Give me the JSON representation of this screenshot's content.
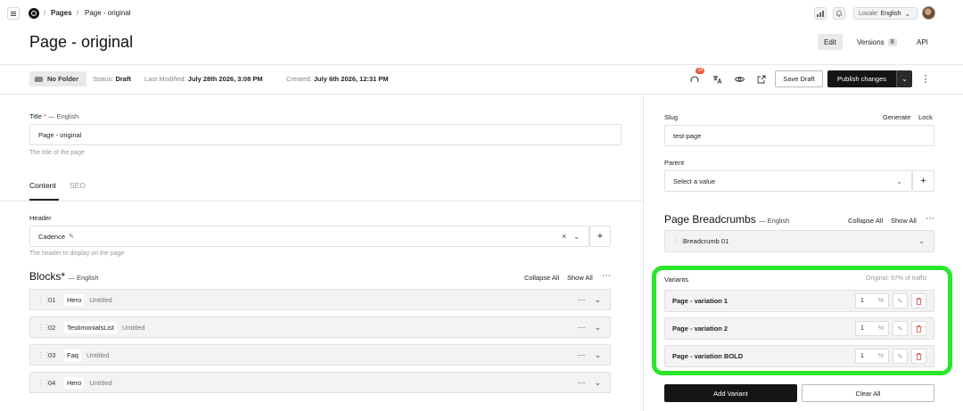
{
  "nav": {
    "breadcrumb_pages": "Pages",
    "breadcrumb_current": "Page - original",
    "locale_label": "Locale:",
    "locale_value": "English"
  },
  "header": {
    "title": "Page - original",
    "tabs": [
      {
        "label": "Edit"
      },
      {
        "label": "Versions",
        "count": "8"
      },
      {
        "label": "API"
      }
    ]
  },
  "status": {
    "folder": "No Folder",
    "status_label": "Status:",
    "status_value": "Draft",
    "modified_label": "Last Modified:",
    "modified_value": "July 28th 2026, 3:08 PM",
    "created_label": "Created:",
    "created_value": "July 6th 2026, 12:31 PM",
    "notification_count": "14",
    "save_draft": "Save Draft",
    "publish": "Publish changes"
  },
  "form": {
    "title_label": "Title",
    "title_required": "*",
    "title_locale": "— English",
    "title_value": "Page - original",
    "title_hint": "The title of the page",
    "tabs": [
      "Content",
      "SEO"
    ],
    "header_label": "Header",
    "header_value": "Cadence",
    "header_hint": "The header to display on the page",
    "blocks_title": "Blocks*",
    "blocks_locale": "— English",
    "collapse_all": "Collapse All",
    "show_all": "Show All",
    "blocks": [
      {
        "num": "01",
        "type": "Hero",
        "title": "Untitled"
      },
      {
        "num": "02",
        "type": "TestimonialsList",
        "title": "Untitled"
      },
      {
        "num": "03",
        "type": "Faq",
        "title": "Untitled"
      },
      {
        "num": "04",
        "type": "Hero",
        "title": "Untitled"
      }
    ]
  },
  "sidebar": {
    "slug_label": "Slug",
    "generate": "Generate",
    "lock": "Lock",
    "slug_value": "test-page",
    "parent_label": "Parent",
    "parent_placeholder": "Select a value",
    "breadcrumbs_title": "Page Breadcrumbs",
    "breadcrumbs_locale": "— English",
    "collapse_all": "Collapse All",
    "show_all": "Show All",
    "breadcrumb_item": "Breadcrumb 01",
    "variants_label": "Variants",
    "variants_traffic": "Original: 97% of traffic",
    "variants": [
      {
        "name": "Page - variation 1",
        "pct": "1",
        "unit": "%"
      },
      {
        "name": "Page - variation 2",
        "pct": "1",
        "unit": "%"
      },
      {
        "name": "Page - variation BOLD",
        "pct": "1",
        "unit": "%"
      }
    ],
    "add_variant": "Add Variant",
    "clear_all": "Clear All"
  },
  "colors": {
    "highlight": "#2ae62a",
    "primary_button": "#151515",
    "badge": "#e8593b",
    "delete": "#d9453b"
  },
  "icons": [
    "menu-icon",
    "logo-icon",
    "chart-icon",
    "bell-icon",
    "folder-icon",
    "comments-icon",
    "translate-icon",
    "eye-icon",
    "external-link-icon",
    "chevron-down-icon",
    "kebab-icon",
    "edit-icon",
    "close-icon",
    "plus-icon",
    "drag-handle-icon",
    "trash-icon"
  ]
}
